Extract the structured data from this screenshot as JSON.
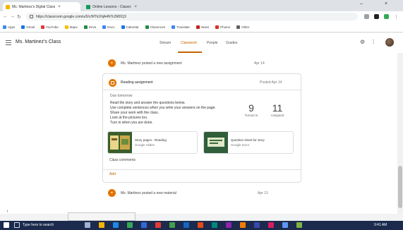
{
  "browser": {
    "tabs": [
      {
        "label": "Ms. Martinez's Digital Class",
        "active": true
      },
      {
        "label": "Online Lessons - Classroom",
        "active": false
      }
    ],
    "window_controls": [
      "–",
      "×"
    ],
    "url": "https://classroom.google.com/u/0/c/MTk1NjA4NTc2MDQ3",
    "bookmarks": [
      "Apps",
      "Gmail",
      "YouTube",
      "Maps",
      "Drive",
      "Docs",
      "Calendar",
      "Classroom",
      "Translate",
      "News",
      "Photos",
      "Other"
    ]
  },
  "app": {
    "class_title": "Ms. Martinez's Class",
    "tabs": [
      "Stream",
      "Classwork",
      "People",
      "Grades"
    ],
    "active_tab": "Classwork"
  },
  "stream": {
    "top_row": {
      "text": "Ms. Martinez posted a new assignment",
      "date": "Apr 14"
    },
    "card": {
      "title": "Reading assignment",
      "date": "Posted Apr 14",
      "due": "Due tomorrow",
      "instructions": [
        "Read the story and answer the questions below.",
        "Use complete sentences when you write your answers on the page.",
        "Share your work with the class.",
        "Look at the pictures too.",
        "Turn in when you are done."
      ],
      "stats": [
        {
          "value": "9",
          "label": "Turned in"
        },
        {
          "value": "11",
          "label": "Assigned"
        }
      ],
      "attachments": [
        {
          "title": "Story pages - Reading",
          "sub": "Google Slides"
        },
        {
          "title": "Question sheet for story",
          "sub": "Google Docs"
        }
      ],
      "footer_left": "Class comments",
      "footer_link": "Add"
    },
    "bottom_row": {
      "text": "Ms. Martinez posted a new material",
      "date": "Apr 13"
    }
  },
  "bottom": {
    "left_label": "i",
    "taskbar_search": "Type here to search",
    "tray_time": "9:41 AM"
  },
  "colors": {
    "accent": "#e37400",
    "taskbar": "#1b2a4d"
  }
}
